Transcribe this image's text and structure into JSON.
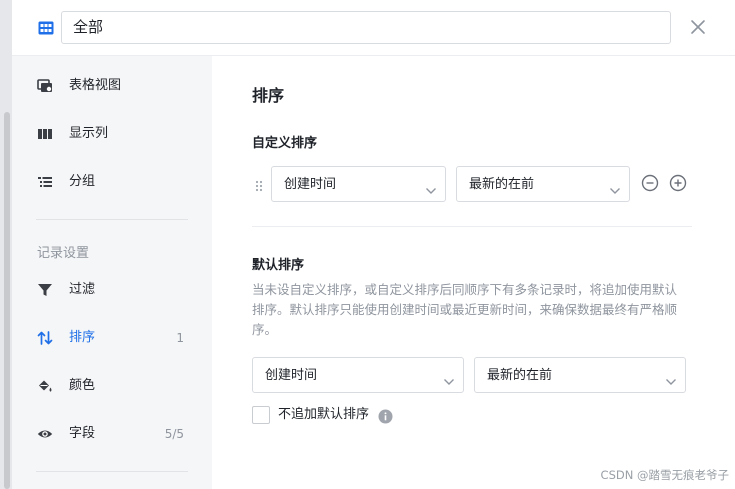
{
  "header": {
    "view_name": "全部",
    "view_icon": "table-grid-icon",
    "close_icon": "close-icon"
  },
  "sidebar": {
    "items": [
      {
        "label": "表格视图",
        "icon": "table-view-icon",
        "count": ""
      },
      {
        "label": "显示列",
        "icon": "columns-icon",
        "count": ""
      },
      {
        "label": "分组",
        "icon": "group-list-icon",
        "count": ""
      }
    ],
    "section_title": "记录设置",
    "record_items": [
      {
        "label": "过滤",
        "icon": "filter-icon",
        "count": ""
      },
      {
        "label": "排序",
        "icon": "sort-icon",
        "count": "1"
      },
      {
        "label": "颜色",
        "icon": "paint-bucket-icon",
        "count": ""
      },
      {
        "label": "字段",
        "icon": "eye-icon",
        "count": "5/5"
      }
    ],
    "active_item": "排序"
  },
  "main": {
    "title": "排序",
    "custom_sort": {
      "title": "自定义排序",
      "field": "创建时间",
      "order": "最新的在前"
    },
    "default_sort": {
      "title": "默认排序",
      "description": "当未设自定义排序，或自定义排序后同顺序下有多条记录时，将追加使用默认排序。默认排序只能使用创建时间或最近更新时间，来确保数据最终有严格顺序。",
      "field": "创建时间",
      "order": "最新的在前",
      "checkbox_label": "不追加默认排序",
      "checkbox_checked": false
    }
  },
  "watermark": "CSDN @踏雪无痕老爷子",
  "colors": {
    "accent": "#1e6fe8",
    "sidebar_bg": "#f5f6f7",
    "muted_text": "#8f959e",
    "border": "#d8dbe0"
  }
}
